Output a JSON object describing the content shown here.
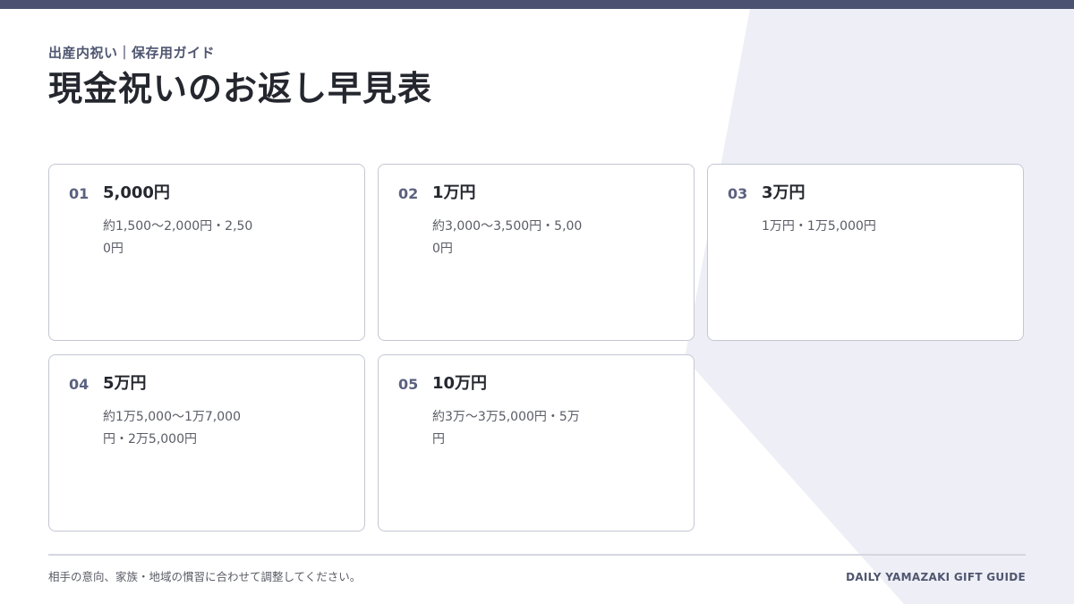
{
  "header": {
    "eyebrow": "出産内祝い｜保存用ガイド",
    "title": "現金祝いのお返し早見表"
  },
  "cards": [
    {
      "num": "01",
      "amount": "5,000円",
      "desc": "約1,500〜2,000円・2,500円"
    },
    {
      "num": "02",
      "amount": "1万円",
      "desc": "約3,000〜3,500円・5,000円"
    },
    {
      "num": "03",
      "amount": "3万円",
      "desc": "1万円・1万5,000円"
    },
    {
      "num": "04",
      "amount": "5万円",
      "desc": "約1万5,000〜1万7,000円・2万5,000円"
    },
    {
      "num": "05",
      "amount": "10万円",
      "desc": "約3万〜3万5,000円・5万円"
    }
  ],
  "footer": {
    "note": "相手の意向、家族・地域の慣習に合わせて調整してください。",
    "brand": "DAILY YAMAZAKI GIFT GUIDE"
  },
  "colors": {
    "top_bar": "#4b5271",
    "background_shape": "#eeeff6"
  }
}
